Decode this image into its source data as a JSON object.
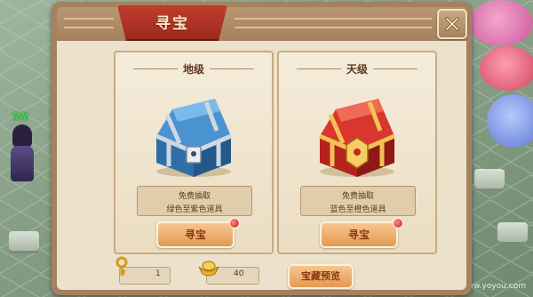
{
  "window": {
    "title": "寻宝"
  },
  "scene": {
    "player_name": "聚聚"
  },
  "cards": [
    {
      "tier": "地级",
      "line1": "免费抽取",
      "line2": "绿色至紫色道具",
      "button": "寻宝",
      "chest_icon": "blue-treasure-chest",
      "has_notification": true
    },
    {
      "tier": "天级",
      "line1": "免费抽取",
      "line2": "蓝色至橙色道具",
      "button": "寻宝",
      "chest_icon": "red-treasure-chest",
      "has_notification": true
    }
  ],
  "resources": {
    "key_count": "1",
    "gold_count": "40",
    "key_icon": "golden-key-icon",
    "gold_icon": "gold-ingot-icon"
  },
  "footer": {
    "preview_label": "宝藏预览"
  },
  "colors": {
    "title_red": "#b8352a",
    "button_orange": "#e9a25c",
    "panel_tan": "#a5825f",
    "card_bg": "#f1e7d3"
  }
}
